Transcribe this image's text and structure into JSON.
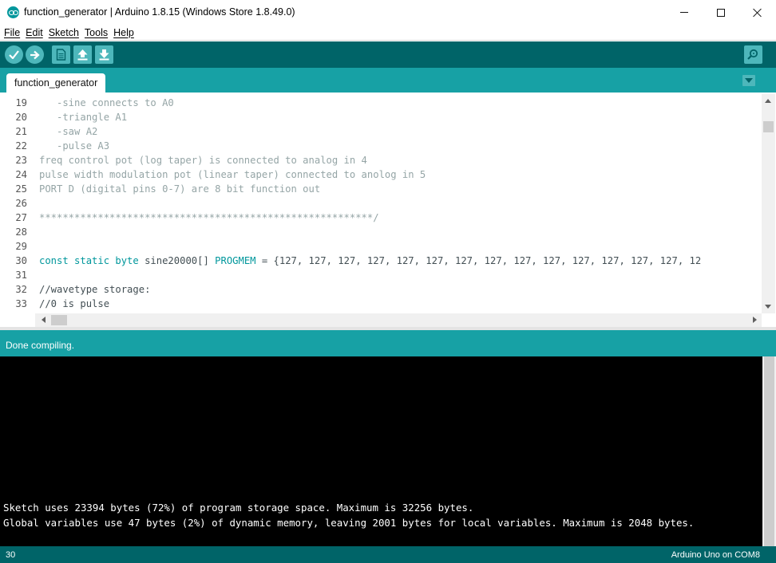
{
  "window": {
    "title": "function_generator | Arduino 1.8.15 (Windows Store 1.8.49.0)"
  },
  "menu": {
    "items": [
      "File",
      "Edit",
      "Sketch",
      "Tools",
      "Help"
    ]
  },
  "toolbar": {
    "buttons": [
      "verify-icon",
      "upload-icon",
      "new-file-icon",
      "open-icon",
      "save-icon",
      "serial-monitor-icon"
    ]
  },
  "tabs": {
    "active": "function_generator"
  },
  "editor": {
    "lines": [
      {
        "n": "19",
        "text": "   -sine connects to A0",
        "style": "cmt"
      },
      {
        "n": "20",
        "text": "   -triangle A1",
        "style": "cmt"
      },
      {
        "n": "21",
        "text": "   -saw A2",
        "style": "cmt"
      },
      {
        "n": "22",
        "text": "   -pulse A3",
        "style": "cmt"
      },
      {
        "n": "23",
        "text": "freq control pot (log taper) is connected to analog in 4",
        "style": "cmt"
      },
      {
        "n": "24",
        "text": "pulse width modulation pot (linear taper) connected to anolog in 5",
        "style": "cmt"
      },
      {
        "n": "25",
        "text": "PORT D (digital pins 0-7) are 8 bit function out",
        "style": "cmt"
      },
      {
        "n": "26",
        "text": "",
        "style": "plain"
      },
      {
        "n": "27",
        "text": "*********************************************************/",
        "style": "cmt"
      },
      {
        "n": "28",
        "text": "",
        "style": "plain"
      },
      {
        "n": "29",
        "text": "",
        "style": "plain"
      },
      {
        "n": "30",
        "text": "",
        "style": "code30"
      },
      {
        "n": "31",
        "text": "",
        "style": "plain"
      },
      {
        "n": "32",
        "text": "//wavetype storage:",
        "style": "plain"
      },
      {
        "n": "33",
        "text": "//0 is pulse",
        "style": "plain"
      }
    ],
    "line30": {
      "kw1": "const static byte",
      "mid": " sine20000[] ",
      "kw2": "PROGMEM",
      "rest": " = {127, 127, 127, 127, 127, 127, 127, 127, 127, 127, 127, 127, 127, 127, 12"
    }
  },
  "status": {
    "message": "Done compiling."
  },
  "console": {
    "lines": [
      "Sketch uses 23394 bytes (72%) of program storage space. Maximum is 32256 bytes.",
      "Global variables use 47 bytes (2%) of dynamic memory, leaving 2001 bytes for local variables. Maximum is 2048 bytes."
    ]
  },
  "footer": {
    "line_number": "30",
    "board": "Arduino Uno on COM8"
  },
  "colors": {
    "toolbar": "#006468",
    "tab_strip": "#17a1a5",
    "button": "#4db7bb",
    "keyword": "#00979c",
    "comment": "#95a5a6"
  }
}
